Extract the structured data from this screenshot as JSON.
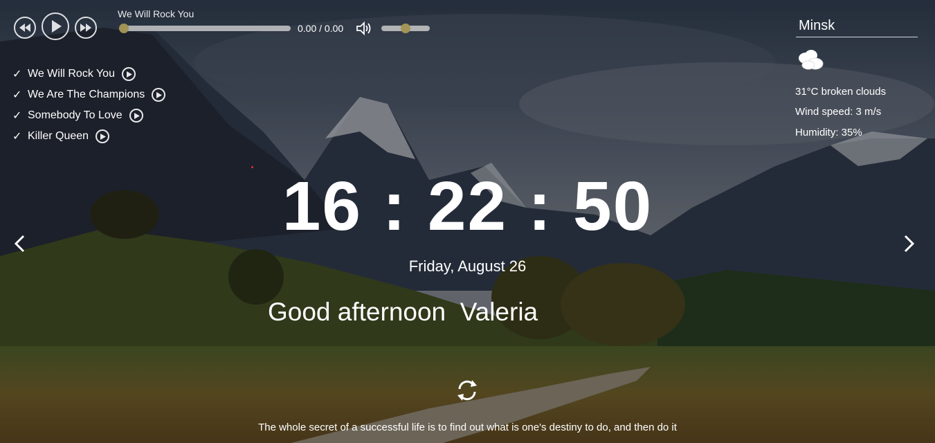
{
  "player": {
    "track_title": "We Will Rock You",
    "time": "0.00 / 0.00",
    "progress": 0,
    "volume": 0.5
  },
  "playlist": [
    {
      "check": "✓",
      "label": "We Will Rock You"
    },
    {
      "check": "✓",
      "label": "We Are The Champions"
    },
    {
      "check": "✓",
      "label": "Somebody To Love"
    },
    {
      "check": "✓",
      "label": "Killer Queen"
    }
  ],
  "weather": {
    "city": "Minsk",
    "icon": "broken-clouds-icon",
    "temp_desc": "31°C   broken clouds",
    "wind": "Wind speed: 3 m/s",
    "humidity": "Humidity: 35%"
  },
  "clock": {
    "time": "16 : 22 : 50",
    "date": "Friday, August 26"
  },
  "greeting": "Good afternoon  Valeria",
  "quote": "The whole secret of a successful life is to find out what is one's destiny to do, and then do it",
  "colors": {
    "knob": "#b6a55a",
    "track": "#c8c8c8"
  }
}
